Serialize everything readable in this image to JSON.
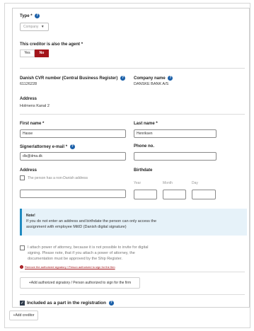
{
  "type_section": {
    "label": "Type",
    "required_mark": "*",
    "select_value": "Company"
  },
  "agent_section": {
    "label": "This creditor is also the agent",
    "required_mark": "*",
    "yes_label": "Yes",
    "no_label": "No",
    "selected": "No"
  },
  "company_section": {
    "cvr_label": "Danish CVR number (Central Business Register)",
    "cvr_value": "61126228",
    "company_name_label": "Company name",
    "company_name_value": "DANSKE BANK A/S",
    "address_label": "Address",
    "address_value": "Holmens Kanal 2"
  },
  "person_section": {
    "first_name_label": "First name",
    "first_name_required": "*",
    "first_name_value": "Hasse",
    "last_name_label": "Last name",
    "last_name_required": "*",
    "last_name_value": "Henriksen",
    "email_label": "Signer/attorney e-mail",
    "email_required": "*",
    "email_value": "dls@dma.dk",
    "phone_label": "Phone no.",
    "phone_value": "",
    "address_label": "Address",
    "non_danish_label": "The person has a non-Danish address",
    "non_danish_checked": false,
    "address_value": "",
    "birthdate_label": "Birthdate",
    "year_label": "Year",
    "month_label": "Month",
    "day_label": "Day",
    "year_value": "",
    "month_value": "",
    "day_value": ""
  },
  "note": {
    "title": "Note!",
    "line1": "If you do not enter an address and birthdate the person can only access the",
    "line2": "assignment with employee MitID (Danish digital signature)"
  },
  "power_of_attorney": {
    "checked": false,
    "line1": "I attach power of attorney, because it is not possible to invite for digital",
    "line2": "signing. Please note, that if you attach a power of attorney, the",
    "line3": "documentation must be approved by the Ship Register."
  },
  "remove_link": "Remove the authorized signatory / Person authorized to sign for the firm",
  "add_signatory_button": "+Add authorized signatory / Person authorized to sign for the firm",
  "included": {
    "label": "Included as a part in the registration",
    "checked": true
  },
  "add_creditor_button": "+Add creditor",
  "colors": {
    "accent_red": "#a3141a",
    "help_blue": "#1a5fa8",
    "note_bg": "#e6f2f9",
    "note_border": "#1f8ac0"
  }
}
